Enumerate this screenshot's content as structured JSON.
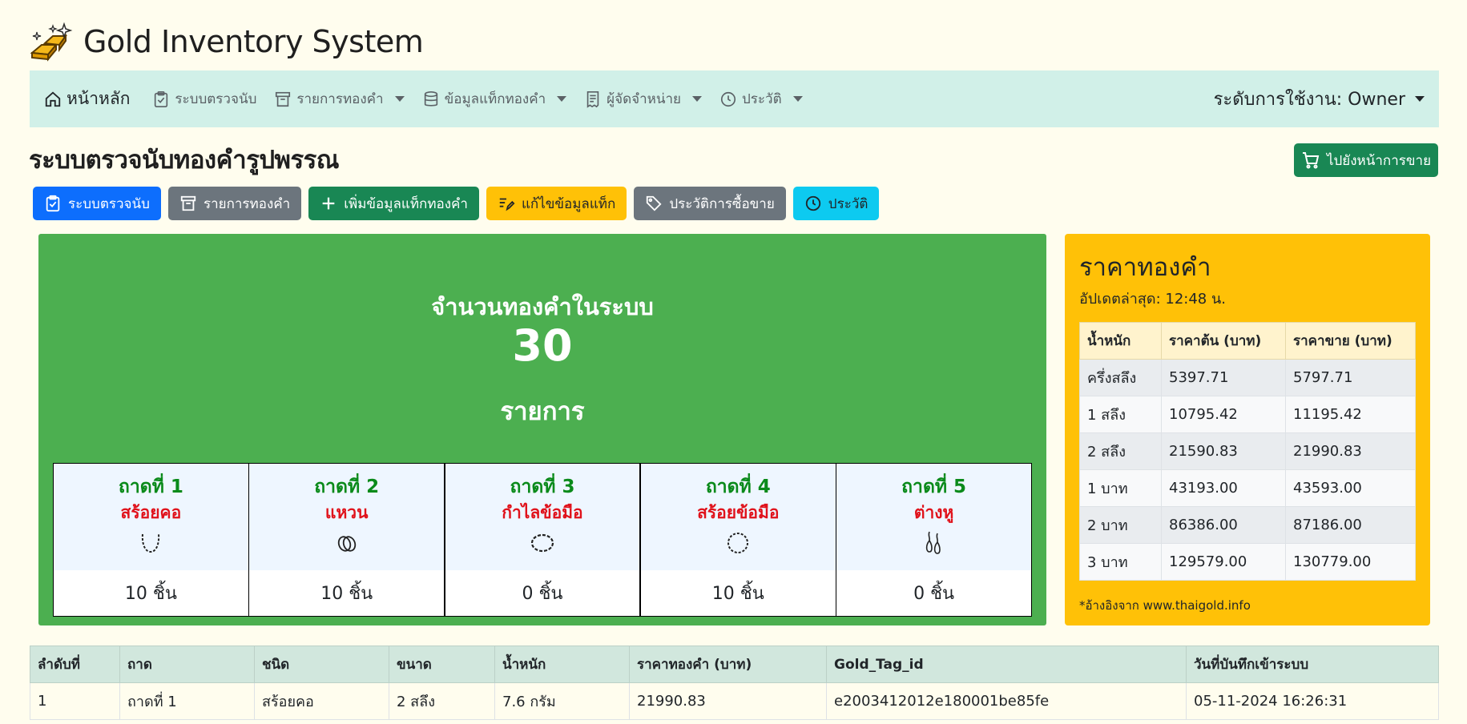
{
  "header": {
    "title": "Gold Inventory System",
    "logo": "gold-bars-sparkle-icon"
  },
  "nav": {
    "home": "หน้าหลัก",
    "items": [
      {
        "label": "ระบบตรวจนับ",
        "icon": "clipboard-check-icon",
        "dropdown": false
      },
      {
        "label": "รายการทองคำ",
        "icon": "archive-icon",
        "dropdown": true
      },
      {
        "label": "ข้อมูลแท็กทองคำ",
        "icon": "database-icon",
        "dropdown": true
      },
      {
        "label": "ผู้จัดจำหน่าย",
        "icon": "receipt-icon",
        "dropdown": true
      },
      {
        "label": "ประวัติ",
        "icon": "clock-icon",
        "dropdown": true
      }
    ],
    "user_level": "ระดับการใช้งาน: Owner"
  },
  "page": {
    "title": "ระบบตรวจนับทองคำรูปพรรณ",
    "sale_button": "ไปยังหน้าการขาย"
  },
  "actions": [
    {
      "label": "ระบบตรวจนับ",
      "color": "#0d6efd",
      "icon": "clipboard-check-icon"
    },
    {
      "label": "รายการทองคำ",
      "color": "#6c757d",
      "icon": "archive-icon"
    },
    {
      "label": "เพิ่มข้อมูลแท็กทองคำ",
      "color": "#198754",
      "icon": "plus-icon"
    },
    {
      "label": "แก้ไขข้อมูลแท็ก",
      "color": "#ffc107",
      "icon": "edit-icon"
    },
    {
      "label": "ประวัติการซื้อขาย",
      "color": "#6c757d",
      "icon": "tag-icon"
    },
    {
      "label": "ประวัติ",
      "color": "#0dcaf0",
      "icon": "clock-icon"
    }
  ],
  "summary": {
    "title": "จำนวนทองคำในระบบ",
    "count": "30",
    "unit": "รายการ",
    "trays": [
      {
        "name": "ถาดที่ 1",
        "type": "สร้อยคอ",
        "icon": "necklace-icon",
        "count": "10 ชิ้น"
      },
      {
        "name": "ถาดที่ 2",
        "type": "แหวน",
        "icon": "rings-icon",
        "count": "10 ชิ้น"
      },
      {
        "name": "ถาดที่ 3",
        "type": "กำไลข้อมือ",
        "icon": "bangle-icon",
        "count": "0 ชิ้น"
      },
      {
        "name": "ถาดที่ 4",
        "type": "สร้อยข้อมือ",
        "icon": "bracelet-icon",
        "count": "10 ชิ้น"
      },
      {
        "name": "ถาดที่ 5",
        "type": "ต่างหู",
        "icon": "earrings-icon",
        "count": "0 ชิ้น"
      }
    ]
  },
  "price": {
    "title": "ราคาทองคำ",
    "updated": "อัปเดตล่าสุด: 12:48 น.",
    "headers": [
      "น้ำหนัก",
      "ราคาต้น (บาท)",
      "ราคาขาย (บาท)"
    ],
    "rows": [
      [
        "ครึ่งสลึง",
        "5397.71",
        "5797.71"
      ],
      [
        "1 สลึง",
        "10795.42",
        "11195.42"
      ],
      [
        "2 สลึง",
        "21590.83",
        "21990.83"
      ],
      [
        "1 บาท",
        "43193.00",
        "43593.00"
      ],
      [
        "2 บาท",
        "86386.00",
        "87186.00"
      ],
      [
        "3 บาท",
        "129579.00",
        "130779.00"
      ]
    ],
    "note": "*อ้างอิงจาก www.thaigold.info"
  },
  "table": {
    "headers": [
      "ลำดับที่",
      "ถาด",
      "ชนิด",
      "ขนาด",
      "น้ำหนัก",
      "ราคาทองคำ (บาท)",
      "Gold_Tag_id",
      "วันที่บันทึกเข้าระบบ"
    ],
    "rows": [
      [
        "1",
        "ถาดที่ 1",
        "สร้อยคอ",
        "2 สลึง",
        "7.6 กรัม",
        "21990.83",
        "e2003412012e180001be85fe",
        "05-11-2024 16:26:31"
      ]
    ]
  },
  "colors": {
    "background": "#fffdee",
    "navbar": "#d1f0e8",
    "summary": "#4caf50",
    "price_card": "#ffc107",
    "tray_name": "#0a8a1a",
    "tray_type": "#e0121b"
  }
}
